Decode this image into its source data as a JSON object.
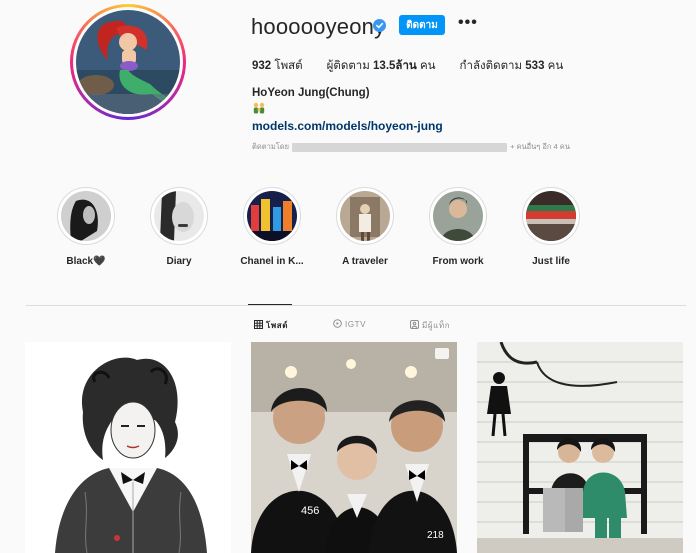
{
  "profile": {
    "username": "hoooooyeony",
    "follow_label": "ติดตาม",
    "more_label": "•••",
    "full_name": "HoYeon Jung(Chung)",
    "website": "models.com/models/hoyeon-jung",
    "followed_by_prefix": "ติดตามโดย",
    "followed_by_suffix": "+ คนอื่นๆ อีก 4 คน"
  },
  "stats": {
    "posts_count": "932",
    "posts_label": "โพสต์",
    "followers_label": "ผู้ติดตาม",
    "followers_count": "13.5ล้าน",
    "followers_unit": "คน",
    "following_label": "กำลังติดตาม",
    "following_count": "533",
    "following_unit": "คน"
  },
  "highlights": [
    {
      "label": "Black🖤"
    },
    {
      "label": "Diary"
    },
    {
      "label": "Chanel in K..."
    },
    {
      "label": "A traveler"
    },
    {
      "label": "From work"
    },
    {
      "label": "Just life"
    }
  ],
  "tabs": [
    {
      "label": "โพสต์",
      "icon": "grid-icon",
      "active": true
    },
    {
      "label": "IGTV",
      "icon": "igtv-icon",
      "active": false
    },
    {
      "label": "มีผู้แท็ก",
      "icon": "tagged-icon",
      "active": false
    }
  ],
  "colors": {
    "accent": "#0095f6",
    "link": "#00376b",
    "muted": "#8e8e8e",
    "background": "#fafafa"
  }
}
